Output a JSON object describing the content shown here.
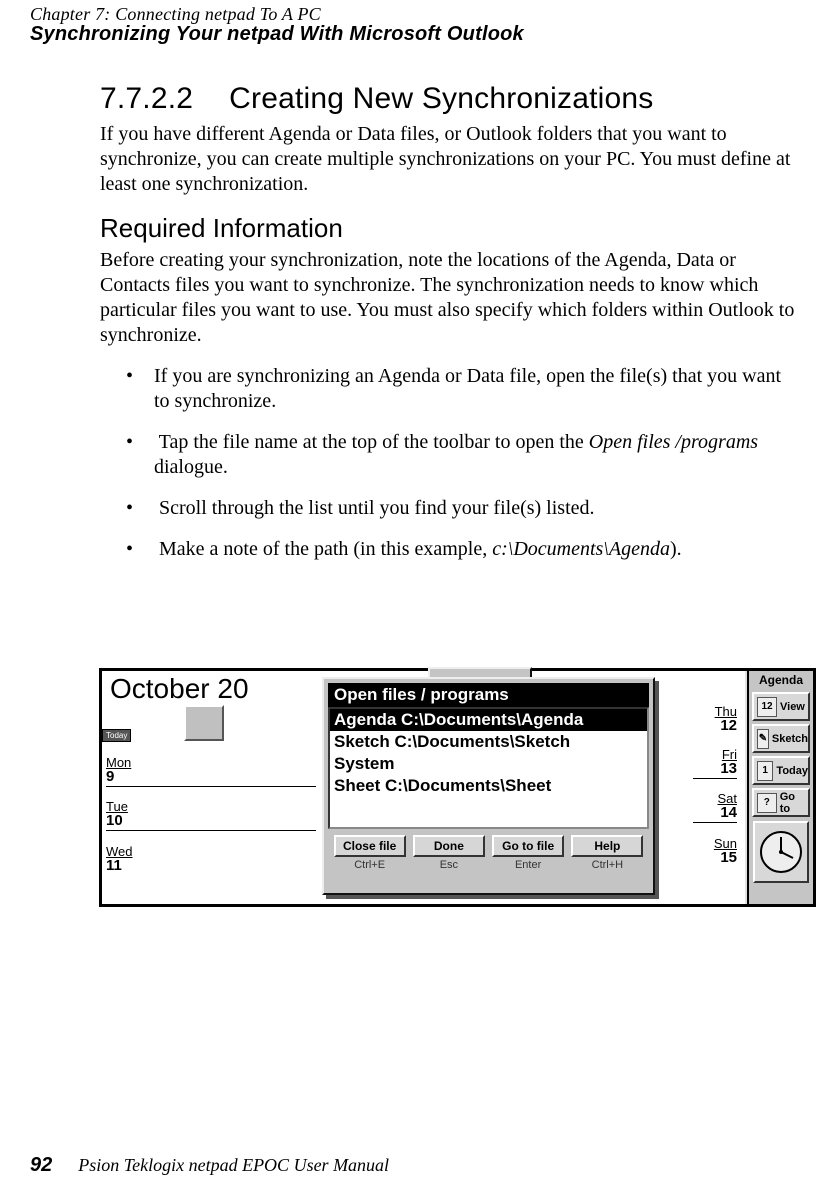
{
  "header": {
    "line1": "Chapter 7:  Connecting netpad To A PC",
    "line2": "Synchronizing Your netpad With Microsoft Outlook"
  },
  "section": {
    "number": "7.7.2.2",
    "title": "Creating New Synchronizations",
    "para": "If you have different Agenda or Data files, or Outlook folders that you want to synchronize, you can create multiple synchronizations on your PC. You must define at least one synchronization."
  },
  "subsection": {
    "title": "Required Information",
    "para": "Before creating your synchronization, note the locations of the Agenda, Data or Contacts files you want to synchronize. The synchronization needs to know which particular files you want to use. You must also specify which folders within Outlook to synchronize."
  },
  "bullets": {
    "b1": "If you are synchronizing an Agenda or Data file, open the file(s) that you want to synchronize.",
    "b2_pre": "Tap the file name at the top of the toolbar to open the ",
    "b2_ital": "Open files /programs",
    "b2_post": " dialogue.",
    "b3": " Scroll through the list until you find your file(s) listed.",
    "b4_pre": "Make a note of the path (in this example, ",
    "b4_ital": "c:\\Documents\\Agenda",
    "b4_post": ")."
  },
  "screenshot": {
    "date_title": "October 20",
    "today_label": "Today",
    "left_days": [
      {
        "abbr": "Mon",
        "num": "9"
      },
      {
        "abbr": "Tue",
        "num": "10"
      },
      {
        "abbr": "Wed",
        "num": "11"
      }
    ],
    "right_days": [
      {
        "abbr": "Thu",
        "num": "12"
      },
      {
        "abbr": "Fri",
        "num": "13"
      },
      {
        "abbr": "Sat",
        "num": "14"
      },
      {
        "abbr": "Sun",
        "num": "15"
      }
    ],
    "dialog": {
      "title": "Open files / programs",
      "items": [
        "Agenda C:\\Documents\\Agenda",
        "Sketch C:\\Documents\\Sketch",
        "System",
        "Sheet C:\\Documents\\Sheet"
      ],
      "buttons": [
        {
          "label": "Close file",
          "key": "Ctrl+E"
        },
        {
          "label": "Done",
          "key": "Esc"
        },
        {
          "label": "Go to file",
          "key": "Enter"
        },
        {
          "label": "Help",
          "key": "Ctrl+H"
        }
      ]
    },
    "sidebar": {
      "title": "Agenda",
      "buttons": [
        {
          "icon": "12",
          "label": "View"
        },
        {
          "icon": "✎",
          "label": "Sketch"
        },
        {
          "icon": "1",
          "label": "Today"
        },
        {
          "icon": "?",
          "label": "Go to"
        }
      ]
    }
  },
  "footer": {
    "page": "92",
    "text": "Psion Teklogix netpad EPOC User Manual"
  }
}
